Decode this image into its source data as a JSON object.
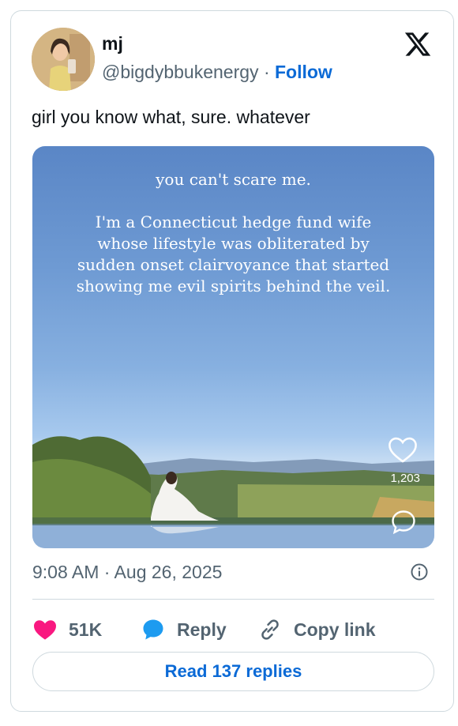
{
  "author": {
    "name": "mj",
    "handle": "@bigdybbukenergy",
    "separator": "·",
    "follow_label": "Follow"
  },
  "tweet": {
    "text": "girl you know what, sure. whatever",
    "timestamp": "9:08 AM · Aug 26, 2025"
  },
  "media": {
    "overlay_line1": "you can't scare me.",
    "overlay_line2": "I'm a Connecticut hedge fund wife",
    "overlay_line3": "whose lifestyle was obliterated by",
    "overlay_line4": "sudden onset clairvoyance that started",
    "overlay_line5": "showing me evil spirits behind the veil.",
    "like_count": "1,203"
  },
  "actions": {
    "likes": "51K",
    "reply_label": "Reply",
    "copy_label": "Copy link"
  },
  "read_replies_label": "Read 137 replies",
  "colors": {
    "like": "#f91880",
    "reply": "#1d9bf0",
    "link_blue": "#0b6ad6",
    "muted": "#536471"
  },
  "icons": [
    "x-logo-icon",
    "heart-icon",
    "comment-icon",
    "info-icon",
    "like-heart-icon",
    "reply-bubble-icon",
    "copy-link-icon"
  ]
}
